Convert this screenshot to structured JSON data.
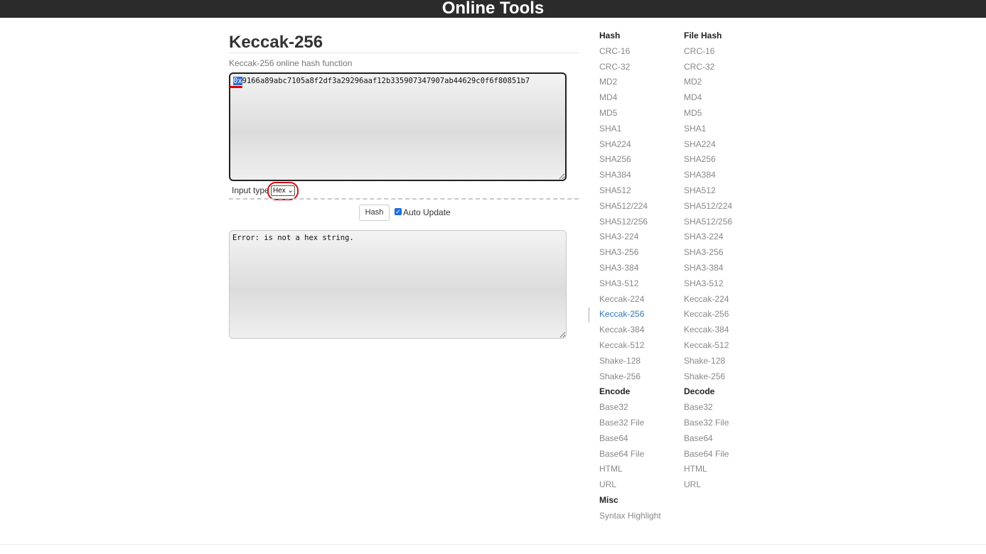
{
  "site_title": "Online Tools",
  "page": {
    "title": "Keccak-256",
    "subtitle": "Keccak-256 online hash function"
  },
  "input": {
    "prefix": "0x",
    "rest": "9166a89abc7105a8f2df3a29296aaf12b335907347907ab44629c0f6f80851b7"
  },
  "input_type": {
    "label": "Input type",
    "selected": "Hex",
    "selected_display": "Hex ⌄"
  },
  "controls": {
    "hash_button": "Hash",
    "auto_update_label": "Auto Update",
    "auto_update_checked": true,
    "check_mark": "✓"
  },
  "output": {
    "text": "Error: is not a hex string."
  },
  "nav_left": [
    {
      "label": "Hash",
      "type": "head"
    },
    {
      "label": "CRC-16"
    },
    {
      "label": "CRC-32"
    },
    {
      "label": "MD2"
    },
    {
      "label": "MD4"
    },
    {
      "label": "MD5"
    },
    {
      "label": "SHA1"
    },
    {
      "label": "SHA224"
    },
    {
      "label": "SHA256"
    },
    {
      "label": "SHA384"
    },
    {
      "label": "SHA512"
    },
    {
      "label": "SHA512/224"
    },
    {
      "label": "SHA512/256"
    },
    {
      "label": "SHA3-224"
    },
    {
      "label": "SHA3-256"
    },
    {
      "label": "SHA3-384"
    },
    {
      "label": "SHA3-512"
    },
    {
      "label": "Keccak-224"
    },
    {
      "label": "Keccak-256",
      "active": true
    },
    {
      "label": "Keccak-384"
    },
    {
      "label": "Keccak-512"
    },
    {
      "label": "Shake-128"
    },
    {
      "label": "Shake-256"
    },
    {
      "label": "Encode",
      "type": "head"
    },
    {
      "label": "Base32"
    },
    {
      "label": "Base32 File"
    },
    {
      "label": "Base64"
    },
    {
      "label": "Base64 File"
    },
    {
      "label": "HTML"
    },
    {
      "label": "URL"
    },
    {
      "label": "Misc",
      "type": "head"
    },
    {
      "label": "Syntax Highlight"
    }
  ],
  "nav_right": [
    {
      "label": "File Hash",
      "type": "head"
    },
    {
      "label": "CRC-16"
    },
    {
      "label": "CRC-32"
    },
    {
      "label": "MD2"
    },
    {
      "label": "MD4"
    },
    {
      "label": "MD5"
    },
    {
      "label": "SHA1"
    },
    {
      "label": "SHA224"
    },
    {
      "label": "SHA256"
    },
    {
      "label": "SHA384"
    },
    {
      "label": "SHA512"
    },
    {
      "label": "SHA512/224"
    },
    {
      "label": "SHA512/256"
    },
    {
      "label": "SHA3-224"
    },
    {
      "label": "SHA3-256"
    },
    {
      "label": "SHA3-384"
    },
    {
      "label": "SHA3-512"
    },
    {
      "label": "Keccak-224"
    },
    {
      "label": "Keccak-256"
    },
    {
      "label": "Keccak-384"
    },
    {
      "label": "Keccak-512"
    },
    {
      "label": "Shake-128"
    },
    {
      "label": "Shake-256"
    },
    {
      "label": "Decode",
      "type": "head"
    },
    {
      "label": "Base32"
    },
    {
      "label": "Base32 File"
    },
    {
      "label": "Base64"
    },
    {
      "label": "Base64 File"
    },
    {
      "label": "HTML"
    },
    {
      "label": "URL"
    }
  ],
  "colors": {
    "topbar": "#2b2b2b",
    "link": "#888888",
    "active_link": "#337ab7",
    "annotation": "#d01010"
  }
}
